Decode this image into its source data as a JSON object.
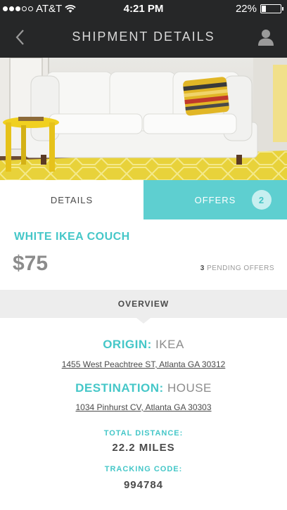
{
  "status": {
    "carrier": "AT&T",
    "time": "4:21 PM",
    "battery": "22%",
    "battery_level": 0.22
  },
  "nav": {
    "title": "SHIPMENT DETAILS",
    "back_icon": "chevron-left-icon",
    "profile_icon": "user-icon"
  },
  "tabs": {
    "details": "DETAILS",
    "offers": "OFFERS",
    "offers_count": "2"
  },
  "item": {
    "title": "WHITE IKEA COUCH",
    "price": "$75",
    "pending_count": "3",
    "pending_label": "PENDING OFFERS"
  },
  "overview": {
    "label": "OVERVIEW",
    "origin_key": "ORIGIN:",
    "origin_value": "IKEA",
    "origin_address": "1455 West Peachtree ST, Atlanta GA 30312",
    "destination_key": "DESTINATION:",
    "destination_value": "HOUSE",
    "destination_address": "1034 Pinhurst CV, Atlanta GA 30303",
    "distance_label": "TOTAL DISTANCE:",
    "distance_value": "22.2 MILES",
    "tracking_label": "TRACKING CODE:",
    "tracking_value": "994784"
  },
  "colors": {
    "accent": "#5ecfd0",
    "accent_text": "#45c7c8",
    "header_bg": "#262728"
  }
}
